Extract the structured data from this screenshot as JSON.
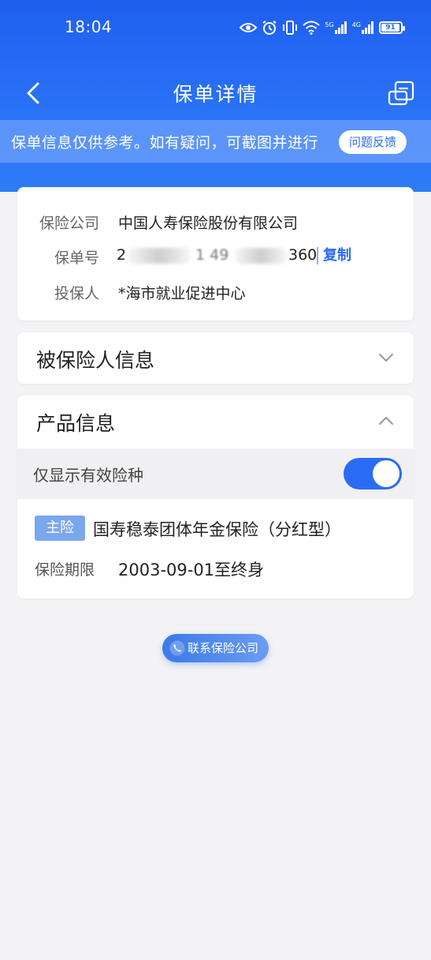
{
  "status_bar": {
    "time": "18:04",
    "signal_5g": "5G",
    "signal_4g": "4G",
    "battery": "91"
  },
  "nav": {
    "title": "保单详情"
  },
  "notice": {
    "text": "保单信息仅供参考。如有疑问，可截图并进行",
    "feedback_label": "问题反馈"
  },
  "policy": {
    "company_label": "保险公司",
    "company_value": "中国人寿保险股份有限公司",
    "number_label": "保单号",
    "number_prefix": "2",
    "number_mid": "1 49",
    "number_suffix": "360",
    "copy_label": "复制",
    "holder_label": "投保人",
    "holder_value": "*海市就业促进中心"
  },
  "insured_section": {
    "title": "被保险人信息"
  },
  "product_section": {
    "title": "产品信息",
    "filter_label": "仅显示有效险种",
    "filter_enabled": true,
    "main_tag": "主险",
    "product_name": "国寿稳泰团体年金保险（分红型）",
    "period_label": "保险期限",
    "period_value": "2003-09-01至终身"
  },
  "contact": {
    "label": "联系保险公司"
  },
  "colors": {
    "brand_blue": "#2a6cf4",
    "header_blue": "#1f5ff0",
    "background": "#f3f3f5"
  }
}
